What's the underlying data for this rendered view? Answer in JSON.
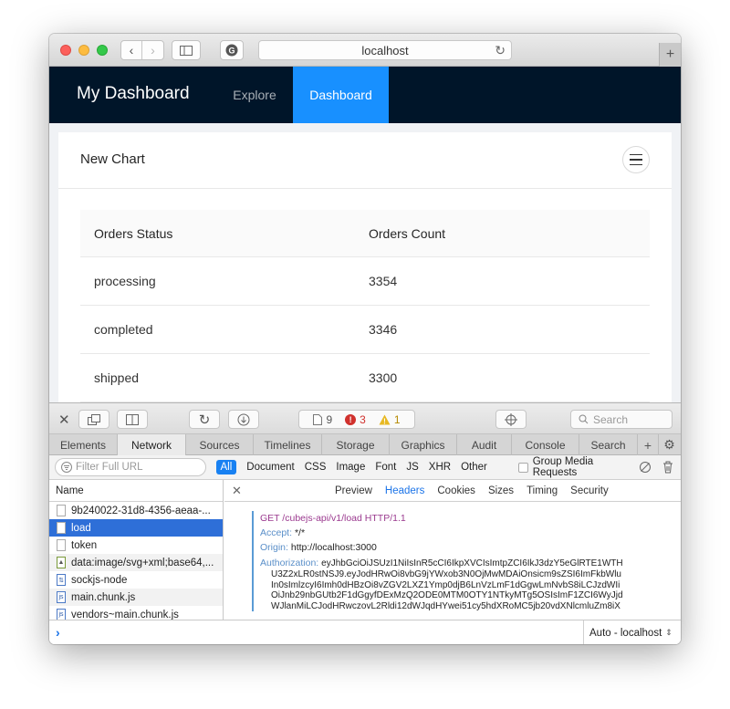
{
  "browser": {
    "address": "localhost"
  },
  "app": {
    "brand": "My Dashboard",
    "nav": [
      {
        "label": "Explore",
        "active": false
      },
      {
        "label": "Dashboard",
        "active": true
      }
    ],
    "accent_color": "#1890ff",
    "header_color": "#001529"
  },
  "card": {
    "title": "New Chart",
    "columns": [
      "Orders Status",
      "Orders Count"
    ],
    "rows": [
      {
        "status": "processing",
        "count": "3354"
      },
      {
        "status": "completed",
        "count": "3346"
      },
      {
        "status": "shipped",
        "count": "3300"
      }
    ]
  },
  "devtools": {
    "resources_count": "9",
    "errors_count": "3",
    "warnings_count": "1",
    "search_placeholder": "Search",
    "tabs": [
      "Elements",
      "Network",
      "Sources",
      "Timelines",
      "Storage",
      "Graphics",
      "Audit",
      "Console",
      "Search"
    ],
    "active_tab": "Network",
    "filter_placeholder": "Filter Full URL",
    "filter_types": [
      "All",
      "Document",
      "CSS",
      "Image",
      "Font",
      "JS",
      "XHR",
      "Other"
    ],
    "group_media_label": "Group Media Requests",
    "list_header": "Name",
    "requests": [
      "9b240022-31d8-4356-aeaa-...",
      "load",
      "token",
      "data:image/svg+xml;base64,...",
      "sockjs-node",
      "main.chunk.js",
      "vendors~main.chunk.js"
    ],
    "detail_tabs": [
      "Preview",
      "Headers",
      "Cookies",
      "Sizes",
      "Timing",
      "Security"
    ],
    "request_line": "GET /cubejs-api/v1/load HTTP/1.1",
    "headers": {
      "accept_key": "Accept:",
      "accept_val": "*/*",
      "origin_key": "Origin:",
      "origin_val": "http://localhost:3000",
      "auth_key": "Authorization:",
      "auth_val_1": "eyJhbGciOiJSUzI1NiIsInR5cCI6IkpXVCIsImtpZCI6IkJ3dzY5eGlRTE1WTH",
      "auth_val_2": "U3Z2xLR0stNSJ9.eyJodHRwOi8vbG9jYWxob3N0OjMwMDAiOnsicm9sZSI6ImFkbWlu",
      "auth_val_3": "In0sImlzcyI6Imh0dHBzOi8vZGV2LXZ1Ymp0djB6LnVzLmF1dGgwLmNvbS8iLCJzdWIi",
      "auth_val_4": "OiJnb29nbGUtb2F1dGgyfDExMzQ2ODE0MTM0OTY1NTkyMTg5OSIsImF1ZCI6WyJjd",
      "auth_val_5": "WJlanMiLCJodHRwczovL2Rldi12dWJqdHYwei51cy5hdXRoMC5jb20vdXNlcmluZm8iX"
    },
    "console_context": "Auto - localhost"
  }
}
